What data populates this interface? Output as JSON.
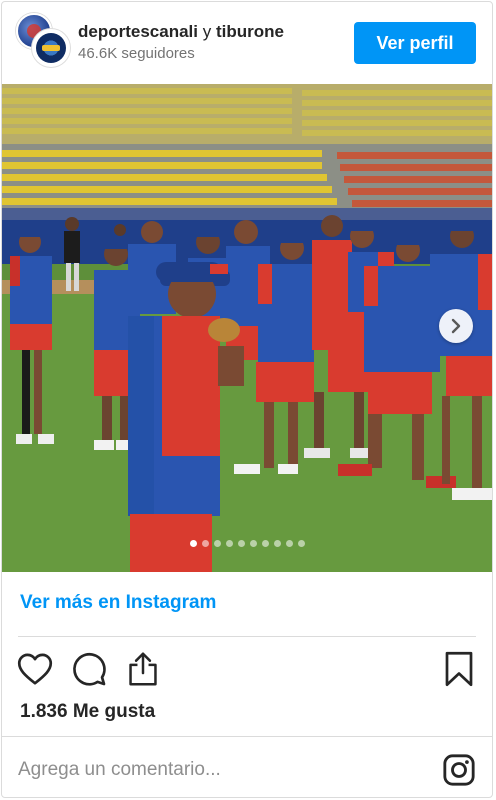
{
  "header": {
    "username": "deportescanali",
    "conjunction": "y",
    "coauthor": "tiburone",
    "followers": "46.6K seguidores",
    "profile_button": "Ver perfil"
  },
  "carousel": {
    "slide_count": 10,
    "active_index": 0,
    "next_icon": "chevron-right-icon"
  },
  "link": {
    "view_more": "Ver más en Instagram"
  },
  "actions": {
    "icons": [
      "heart-icon",
      "comment-icon",
      "share-icon",
      "bookmark-icon"
    ]
  },
  "likes": "1.836 Me gusta",
  "comment": {
    "placeholder": "Agrega un comentario..."
  },
  "footer_icon": "instagram-icon",
  "colors": {
    "accent": "#0095f6",
    "text": "#262626",
    "muted": "#8e8e8e",
    "divider": "#dbdbdb"
  }
}
